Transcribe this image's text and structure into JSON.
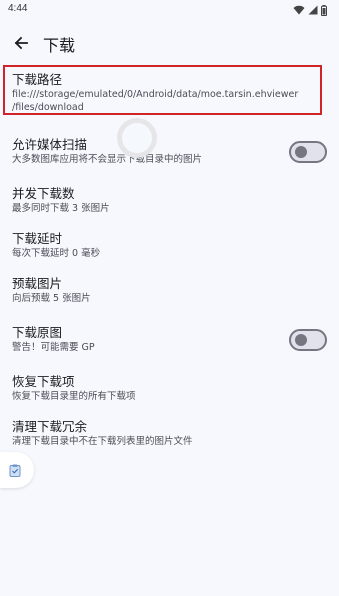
{
  "status": {
    "time": "4:44"
  },
  "app_bar": {
    "title": "下载"
  },
  "settings": [
    {
      "title": "下载路径",
      "summary_line1": "file:///storage/emulated/0/Android/data/moe.tarsin.ehviewer",
      "summary_line2": "/files/download"
    },
    {
      "title": "允许媒体扫描",
      "summary": "大多数图库应用将不会显示下载目录中的图片",
      "switch_on": false
    },
    {
      "title": "并发下载数",
      "summary": "最多同时下载 3 张图片"
    },
    {
      "title": "下载延时",
      "summary": "每次下载延时 0 毫秒"
    },
    {
      "title": "预载图片",
      "summary": "向后预载 5 张图片"
    },
    {
      "title": "下载原图",
      "summary": "警告！可能需要 GP",
      "switch_on": false
    },
    {
      "title": "恢复下载项",
      "summary": "恢复下载目录里的所有下载项"
    },
    {
      "title": "清理下载冗余",
      "summary": "清理下载目录中不在下载列表里的图片文件"
    }
  ],
  "icons": {
    "back": "arrow-back-icon",
    "wifi": "wifi-icon",
    "signal": "signal-icon",
    "battery": "battery-icon",
    "side_tab": "clipboard-icon"
  },
  "colors": {
    "background": "#f6f8fd",
    "highlight": "#d1232a",
    "switch_outline": "#74777f"
  }
}
